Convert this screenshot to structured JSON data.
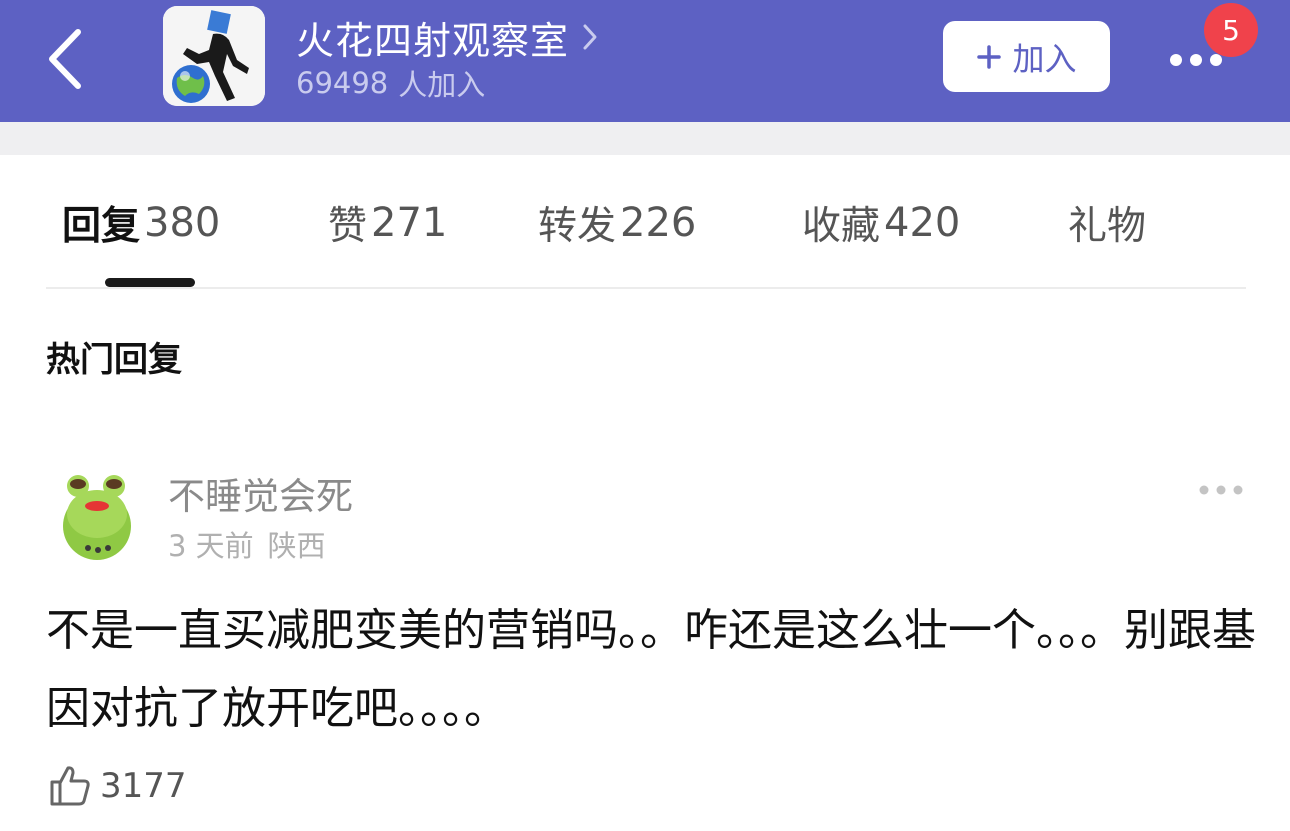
{
  "header": {
    "group_name": "火花四射观察室",
    "member_count": "69498",
    "member_suffix": "人加入",
    "join_label": "加入",
    "notification_badge": "5",
    "background_color": "#5d61c3"
  },
  "tabs": [
    {
      "label": "回复",
      "count": "380",
      "active": true
    },
    {
      "label": "赞",
      "count": "271",
      "active": false
    },
    {
      "label": "转发",
      "count": "226",
      "active": false
    },
    {
      "label": "收藏",
      "count": "420",
      "active": false
    },
    {
      "label": "礼物",
      "count": "",
      "active": false
    }
  ],
  "hot_replies": {
    "title": "热门回复",
    "comments": [
      {
        "user_name": "不睡觉会死",
        "time": "3 天前",
        "location": "陕西",
        "text": "不是一直买减肥变美的营销吗。。咋还是这么壮一个。。。别跟基因对抗了放开吃吧。。。。",
        "likes": "3177",
        "avatar_icon": "frog-avatar-icon"
      }
    ]
  }
}
